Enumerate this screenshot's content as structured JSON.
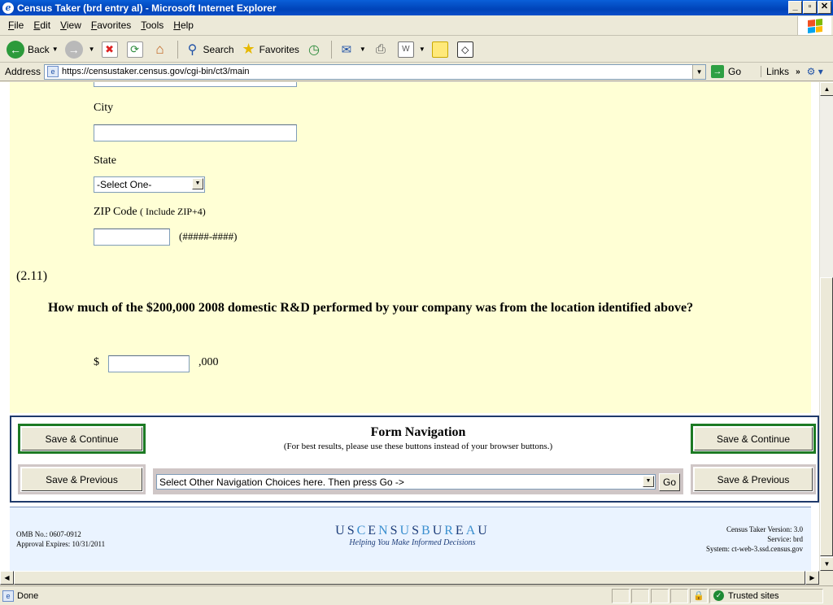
{
  "window": {
    "title": "Census Taker (brd entry al) - Microsoft Internet Explorer"
  },
  "menu": [
    {
      "key": "F",
      "rest": "ile"
    },
    {
      "key": "E",
      "rest": "dit"
    },
    {
      "key": "V",
      "rest": "iew"
    },
    {
      "key": "F",
      "rest": "avorites"
    },
    {
      "key": "T",
      "rest": "ools"
    },
    {
      "key": "H",
      "rest": "elp"
    }
  ],
  "toolbar": {
    "back": "Back",
    "search": "Search",
    "favorites": "Favorites"
  },
  "address": {
    "label": "Address",
    "url": "https://censustaker.census.gov/cgi-bin/ct3/main",
    "go": "Go",
    "links": "Links"
  },
  "form": {
    "city_label": "City",
    "city_value": "",
    "state_label": "State",
    "state_selected": "-Select One-",
    "zip_label": "ZIP Code",
    "zip_hint": "( Include ZIP+4)",
    "zip_value": "",
    "zip_format": "(#####-####)",
    "question_number": "(2.11)",
    "question_text": "How much of the $200,000 2008 domestic R&D performed by your company was from the location identified above?",
    "dollar": "$",
    "amount_value": "",
    "thousands": ",000"
  },
  "nav": {
    "save_continue": "Save & Continue",
    "save_previous": "Save & Previous",
    "title": "Form Navigation",
    "subtitle": "(For best results, please use these buttons instead of your browser buttons.)",
    "select_text": "Select Other Navigation Choices here. Then press Go ->",
    "go": "Go"
  },
  "footer": {
    "omb": "OMB No.: 0607-0912",
    "approval": "Approval Expires: 10/31/2011",
    "logo_tagline": "Helping You Make Informed Decisions",
    "version": "Census Taker Version: 3.0",
    "service": "Service: brd",
    "system": "System: ct-web-3.ssd.census.gov"
  },
  "status": {
    "text": "Done",
    "zone": "Trusted sites"
  }
}
